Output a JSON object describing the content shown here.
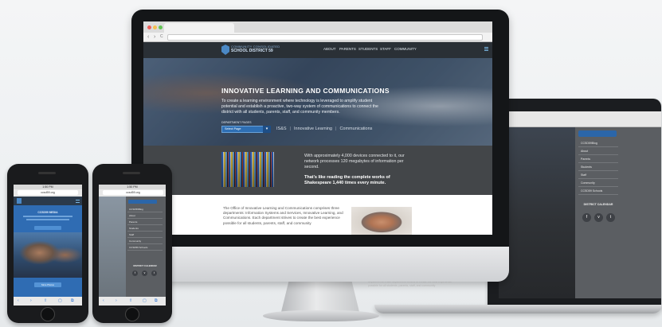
{
  "imac": {
    "browser": {
      "back": "‹",
      "forward": "›",
      "reload": "C"
    },
    "site": {
      "name_line1": "COMMUNITY CONSOLIDATED",
      "name_line2": "SCHOOL DISTRICT 59",
      "nav": [
        "ABOUT",
        "PARENTS",
        "STUDENTS",
        "STAFF",
        "COMMUNITY"
      ]
    },
    "hero": {
      "title": "INNOVATIVE LEARNING AND COMMUNICATIONS",
      "body": "To create a learning environment where technology is leveraged to amplify student potential and establish a proactive, two-way system of communications to connect the district with all students, parents, staff, and community members.",
      "dept_label": "DEPARTMENT PAGES",
      "dept_select": "Select Page",
      "links": [
        "IS&S",
        "Innovative Learning",
        "Communications"
      ]
    },
    "stats": {
      "text": "With approximately 4,000 devices connected to it, our network processes 120 megabytes of information per second.",
      "highlight": "That's like reading the complete works of Shakespeare 1,440 times every minute."
    },
    "office": {
      "text": "The Office of Innovative Learning and Communications comprises three departments: Information Systems and Services, Innovative Learning, and Communications. Each department strives to create the best experience possible for all students, parents, staff, and community"
    }
  },
  "laptop": {
    "menu_items": [
      "CCSD59Blog",
      "About",
      "Parents",
      "Students",
      "Staff",
      "Community",
      "CCSD59 Schools"
    ],
    "calendar_title": "DISTRICT CALENDAR",
    "social": [
      "f",
      "v",
      "t"
    ],
    "bottom_text": "departments. Each department strives to create the best experience possible for all students, parents, staff, and community"
  },
  "phone1": {
    "time": "1:50 PM",
    "url": "ccsd59.org",
    "hero_title": "CCSD59 MEDIA",
    "caption_button": "More Photos"
  },
  "phone2": {
    "time": "1:50 PM",
    "url": "ccsd59.org",
    "menu_items": [
      "CCSD59Blog",
      "About",
      "Parents",
      "Students",
      "Staff",
      "Community",
      "CCSD59 Schools"
    ],
    "calendar_title": "DISTRICT CALENDAR",
    "social": [
      "f",
      "v",
      "t"
    ]
  },
  "toolbar_icons": [
    "‹",
    "›",
    "⇧",
    "▢",
    "⧉"
  ]
}
